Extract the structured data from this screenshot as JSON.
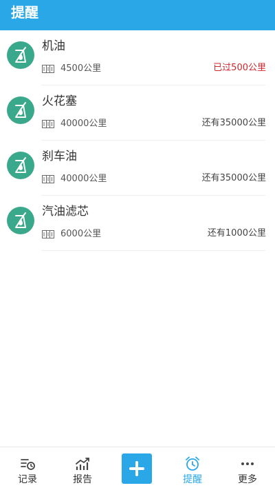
{
  "header": {
    "title": "提醒"
  },
  "reminders": [
    {
      "name": "机油",
      "mileage": "4500公里",
      "status": "已过500公里",
      "overdue": true
    },
    {
      "name": "火花塞",
      "mileage": "40000公里",
      "status": "还有35000公里",
      "overdue": false
    },
    {
      "name": "刹车油",
      "mileage": "40000公里",
      "status": "还有35000公里",
      "overdue": false
    },
    {
      "name": "汽油滤芯",
      "mileage": "6000公里",
      "status": "还有1000公里",
      "overdue": false
    }
  ],
  "tabs": [
    {
      "label": "记录",
      "icon": "record-icon",
      "active": false
    },
    {
      "label": "报告",
      "icon": "report-chart-icon",
      "active": false
    },
    {
      "label": "提醒",
      "icon": "alarm-clock-icon",
      "active": true
    },
    {
      "label": "更多",
      "icon": "more-dots-icon",
      "active": false
    }
  ],
  "add_button": {
    "icon": "plus-icon"
  },
  "colors": {
    "primary": "#2aa7e6",
    "item_icon_bg": "#3aa88a",
    "overdue": "#d0262d",
    "text": "#333333"
  }
}
